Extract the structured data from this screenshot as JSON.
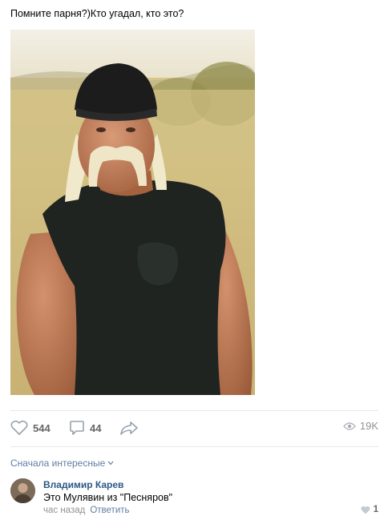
{
  "post": {
    "text": "Помните парня?)Кто угадал, кто это?"
  },
  "actions": {
    "likes": "544",
    "comments": "44",
    "views": "19K"
  },
  "comments_section": {
    "sort_label": "Сначала интересные",
    "items": [
      {
        "author": "Владимир Карев",
        "text": "Это Мулявин из \"Песняров\"",
        "time": "час назад",
        "reply_label": "Ответить",
        "likes": "1"
      }
    ]
  },
  "icons": {
    "like": "heart-icon",
    "comment": "comment-bubble-icon",
    "share": "share-arrow-icon",
    "views": "eye-icon",
    "sort": "chevron-down-icon"
  },
  "colors": {
    "link": "#2a5885",
    "secondary_link": "#5f7ea3",
    "muted": "#828282",
    "divider": "#e7e8ec"
  }
}
